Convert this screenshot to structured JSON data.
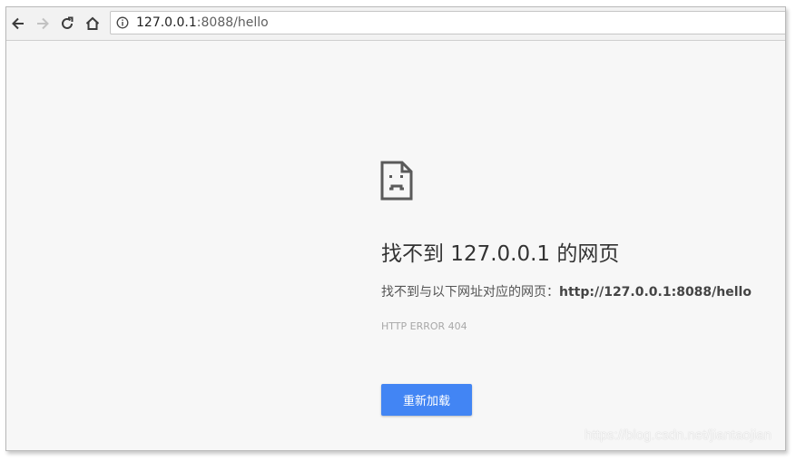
{
  "toolbar": {
    "back_icon": "arrow-left-icon",
    "forward_icon": "arrow-right-icon",
    "reload_icon": "reload-icon",
    "home_icon": "home-icon",
    "info_icon": "info-icon",
    "url_host": "127.0.0.1",
    "url_rest": ":8088/hello"
  },
  "error_page": {
    "icon": "sad-page-icon",
    "title": "找不到 127.0.0.1 的网页",
    "description_prefix": "找不到与以下网址对应的网页：",
    "description_url": "http://127.0.0.1:8088/hello",
    "error_code": "HTTP ERROR 404",
    "reload_label": "重新加载"
  },
  "watermark": "https://blog.csdn.net/jiantaojian",
  "colors": {
    "accent": "#4285f4",
    "page_bg": "#f7f7f7",
    "toolbar_bg": "#f2f2f2"
  }
}
